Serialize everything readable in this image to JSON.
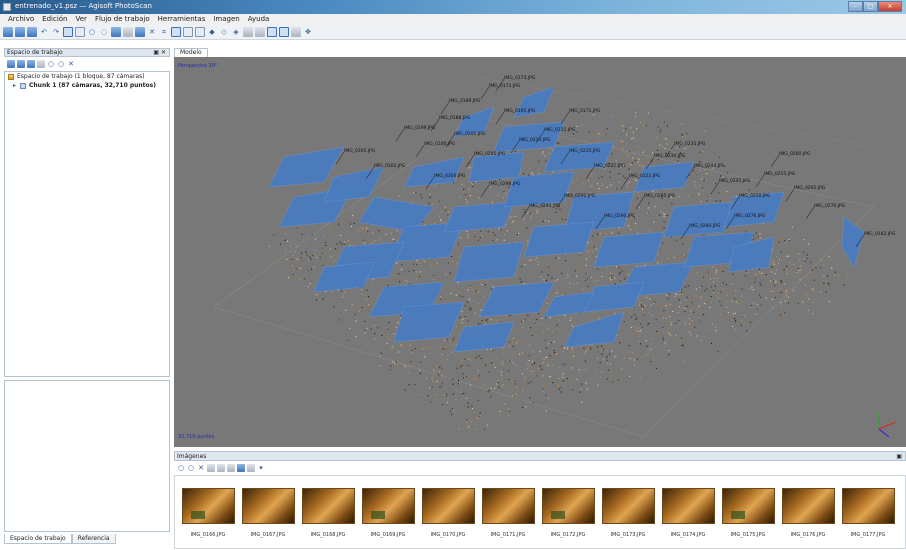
{
  "window": {
    "title": "entrenado_v1.psz — Agisoft PhotoScan"
  },
  "menu": [
    "Archivo",
    "Edición",
    "Ver",
    "Flujo de trabajo",
    "Herramientas",
    "Imagen",
    "Ayuda"
  ],
  "left_panel": {
    "title": "Espacio de trabajo",
    "tree": [
      {
        "label": "Espacio de trabajo (1 bloque, 87 cámaras)"
      },
      {
        "label": "Chunk 1 (87 cámaras, 32,710 puntos)"
      }
    ],
    "tabs": [
      "Espacio de trabajo",
      "Referencia"
    ]
  },
  "model": {
    "tab_label": "Modelo",
    "perspective": "Perspectiva 30°",
    "points_label": "32,710 puntos",
    "camera_labels": [
      "IMG_0173.JPG",
      "IMG_0172.JPG",
      "IMG_0189.JPG",
      "IMG_0188.JPG",
      "IMG_0195.JPG",
      "IMG_0199.JPG",
      "IMG_0200.JPG",
      "IMG_0201.JPG",
      "IMG_0205.JPG",
      "IMG_0210.JPG",
      "IMG_0211.JPG",
      "IMG_0215.JPG",
      "IMG_0220.JPG",
      "IMG_0222.JPG",
      "IMG_0230.JPG",
      "IMG_0235.JPG",
      "IMG_0240.JPG",
      "IMG_0245.JPG",
      "IMG_0250.JPG",
      "IMG_0255.JPG",
      "IMG_0260.JPG",
      "IMG_0265.JPG",
      "IMG_0270.JPG",
      "IMG_0276.JPG",
      "IMG_0280.JPG",
      "IMG_0285.JPG",
      "IMG_0290.JPG",
      "IMG_0292.JPG",
      "IMG_0295.JPG",
      "IMG_0298.JPG",
      "IMG_0300.JPG",
      "IMG_0302.JPG",
      "IMG_0305.JPG",
      "IMG_0171.JPG",
      "IMG_0182.JPG"
    ]
  },
  "images_panel": {
    "title": "Imágenes",
    "thumbnails": [
      "IMG_0166.JPG",
      "IMG_0167.JPG",
      "IMG_0168.JPG",
      "IMG_0169.JPG",
      "IMG_0170.JPG",
      "IMG_0171.JPG",
      "IMG_0172.JPG",
      "IMG_0173.JPG",
      "IMG_0174.JPG",
      "IMG_0175.JPG",
      "IMG_0176.JPG",
      "IMG_0177.JPG"
    ]
  },
  "colors": {
    "camera_plane": "#4a7cc0",
    "viewport_bg": "#787878",
    "point_light": "#c99558",
    "point_dark": "#2b1b0e"
  }
}
